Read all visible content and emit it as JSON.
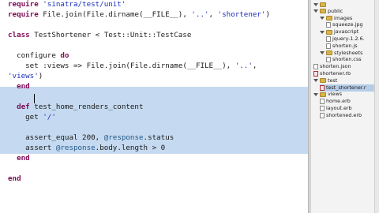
{
  "editor": {
    "lines": [
      [
        {
          "t": "require ",
          "c": "kw"
        },
        {
          "t": "'sinatra/test/unit'",
          "c": "str"
        }
      ],
      [
        {
          "t": "require ",
          "c": "kw"
        },
        {
          "t": "File",
          "c": "cls"
        },
        {
          "t": ".join(",
          "c": "sym"
        },
        {
          "t": "File",
          "c": "cls"
        },
        {
          "t": ".dirname(__FILE__), ",
          "c": "sym"
        },
        {
          "t": "'..'",
          "c": "str"
        },
        {
          "t": ", ",
          "c": "sym"
        },
        {
          "t": "'shortener'",
          "c": "str"
        },
        {
          "t": ")",
          "c": "sym"
        }
      ],
      [],
      [
        {
          "t": "class ",
          "c": "kw"
        },
        {
          "t": "TestShortener",
          "c": "cls"
        },
        {
          "t": " < ",
          "c": "sym"
        },
        {
          "t": "Test::Unit::TestCase",
          "c": "cls"
        }
      ],
      [],
      [
        {
          "t": "  configure ",
          "c": "sym"
        },
        {
          "t": "do",
          "c": "kw"
        }
      ],
      [
        {
          "t": "    set ",
          "c": "sym"
        },
        {
          "t": ":views",
          "c": "sym"
        },
        {
          "t": " => ",
          "c": "sym"
        },
        {
          "t": "File",
          "c": "cls"
        },
        {
          "t": ".join(",
          "c": "sym"
        },
        {
          "t": "File",
          "c": "cls"
        },
        {
          "t": ".dirname(__FILE__), ",
          "c": "sym"
        },
        {
          "t": "'..'",
          "c": "str"
        },
        {
          "t": ",",
          "c": "sym"
        }
      ],
      [
        {
          "t": "'views'",
          "c": "str"
        },
        {
          "t": ")",
          "c": "sym"
        }
      ],
      [
        {
          "t": "  end",
          "c": "kw"
        }
      ],
      [],
      [
        {
          "t": "  def ",
          "c": "kw"
        },
        {
          "t": "test_home_renders_content",
          "c": "sym"
        }
      ],
      [
        {
          "t": "    get ",
          "c": "sym"
        },
        {
          "t": "'/'",
          "c": "str"
        }
      ],
      [],
      [
        {
          "t": "    assert_equal ",
          "c": "sym"
        },
        {
          "t": "200",
          "c": "num"
        },
        {
          "t": ", ",
          "c": "sym"
        },
        {
          "t": "@response",
          "c": "ivar"
        },
        {
          "t": ".status",
          "c": "sym"
        }
      ],
      [
        {
          "t": "    assert ",
          "c": "sym"
        },
        {
          "t": "@response",
          "c": "ivar"
        },
        {
          "t": ".body.length > ",
          "c": "sym"
        },
        {
          "t": "0",
          "c": "num"
        }
      ],
      [
        {
          "t": "  end",
          "c": "kw"
        }
      ],
      [],
      [
        {
          "t": "end",
          "c": "kw"
        }
      ]
    ]
  },
  "tree": {
    "nodes": [
      {
        "label": "",
        "type": "folder",
        "depth": 0,
        "expanded": true
      },
      {
        "label": "public",
        "type": "folder",
        "depth": 0,
        "expanded": true
      },
      {
        "label": "images",
        "type": "folder",
        "depth": 1,
        "expanded": true
      },
      {
        "label": "squeeze.jpg",
        "type": "file",
        "depth": 2
      },
      {
        "label": "javascript",
        "type": "folder",
        "depth": 1,
        "expanded": true
      },
      {
        "label": "jquery-1.2.6.",
        "type": "file",
        "depth": 2
      },
      {
        "label": "shorten.js",
        "type": "file",
        "depth": 2
      },
      {
        "label": "stylesheets",
        "type": "folder",
        "depth": 1,
        "expanded": true
      },
      {
        "label": "shorten.css",
        "type": "file",
        "depth": 2
      },
      {
        "label": "shorten.json",
        "type": "file",
        "depth": 0
      },
      {
        "label": "shortener.rb",
        "type": "ruby",
        "depth": 0
      },
      {
        "label": "test",
        "type": "folder",
        "depth": 0,
        "expanded": true
      },
      {
        "label": "test_shortener.r",
        "type": "ruby",
        "depth": 1,
        "selected": true
      },
      {
        "label": "views",
        "type": "folder",
        "depth": 0,
        "expanded": true
      },
      {
        "label": "home.erb",
        "type": "file",
        "depth": 1
      },
      {
        "label": "layout.erb",
        "type": "file",
        "depth": 1
      },
      {
        "label": "shortened.erb",
        "type": "file",
        "depth": 1
      }
    ]
  }
}
